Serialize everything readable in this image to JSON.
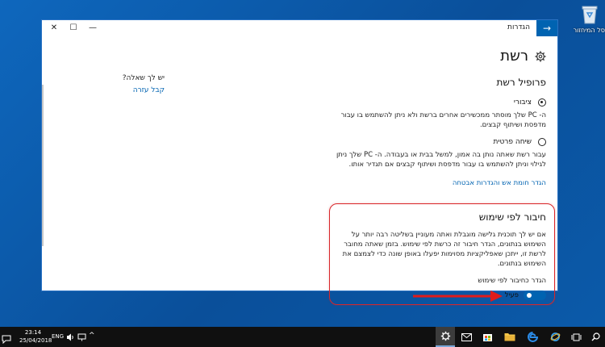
{
  "desktop": {
    "recycle_bin_label": "סל המיחזור"
  },
  "window": {
    "title": "הגדרות",
    "controls": {
      "minimize": "—",
      "maximize": "☐",
      "close": "✕"
    },
    "back_icon": "arrow-right-icon"
  },
  "page": {
    "title": "רשת",
    "icon": "gear-icon"
  },
  "help": {
    "question": "יש לך שאלה?",
    "link": "קבל עזרה"
  },
  "profile": {
    "title": "פרופיל רשת",
    "options": [
      {
        "label": "ציבורי",
        "selected": true,
        "description": "ה- PC שלך מוסתר ממכשירים אחרים ברשת ולא ניתן להשתמש בו עבור מדפסת ושיתוף קבצים."
      },
      {
        "label": "שיחה פרטית",
        "selected": false,
        "description": "עבור רשת שאתה נותן בה אמון, למשל בבית או בעבודה. ה- PC שלך ניתן לגילוי וניתן להשתמש בו עבור מדפסת ושיתוף קבצים אם תגדיר אותו."
      }
    ],
    "firewall_link": "הגדר חומת אש והגדרות אבטחה"
  },
  "metered": {
    "title": "חיבור לפי שימוש",
    "description": "אם יש לך תוכנית גלישה מוגבלת ואתה מעוניין בשליטה רבה יותר על השימוש בנתונים, הגדר חיבור זה כרשת לפי שימוש. בזמן שאתה מחובר לרשת זו, ייתכן שאפליקציות מסוימות יפעלו באופן שונה כדי לצמצם את השימוש בנתונים.",
    "setting_label": "הגדר כחיבור לפי שימוש",
    "toggle_state": "פעיל",
    "toggle_on": true
  },
  "taskbar": {
    "time": "23:14",
    "date": "25/04/2018",
    "language": "ENG",
    "icons": [
      "notification-icon",
      "volume-icon",
      "network-icon",
      "settings-icon",
      "mail-icon",
      "store-icon",
      "file-explorer-icon",
      "edge-icon",
      "ie-icon",
      "task-view-icon",
      "search-icon",
      "start-icon"
    ]
  },
  "colors": {
    "accent": "#0063b1",
    "highlight_border": "#d9262a",
    "taskbar": "#101010"
  }
}
